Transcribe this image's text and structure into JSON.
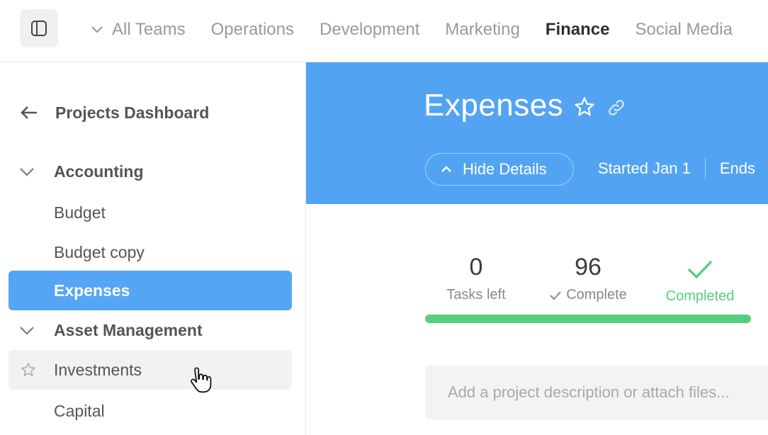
{
  "topbar": {
    "toggle_icon": "sidebar-panel-icon",
    "tabs": [
      {
        "label": "All Teams"
      },
      {
        "label": "Operations"
      },
      {
        "label": "Development"
      },
      {
        "label": "Marketing"
      },
      {
        "label": "Finance"
      },
      {
        "label": "Social Media"
      }
    ],
    "active_tab": "Finance"
  },
  "sidebar": {
    "back_label": "Projects Dashboard",
    "groups": [
      {
        "label": "Accounting",
        "items": [
          {
            "label": "Budget"
          },
          {
            "label": "Budget copy"
          },
          {
            "label": "Expenses"
          }
        ]
      },
      {
        "label": "Asset Management",
        "items": [
          {
            "label": "Investments"
          },
          {
            "label": "Capital"
          }
        ]
      }
    ],
    "active_item": "Expenses",
    "hover_item": "Investments"
  },
  "project": {
    "title": "Expenses",
    "hide_details_label": "Hide Details",
    "started": "Started Jan 1",
    "ends": "Ends"
  },
  "stats": {
    "tasks_left_value": "0",
    "tasks_left_label": "Tasks left",
    "complete_value": "96",
    "complete_label": "Complete",
    "completed_label": "Completed",
    "progress": 1.0
  },
  "description": {
    "placeholder": "Add a project description or attach files..."
  },
  "colors": {
    "accent": "#52a4f3",
    "active_item": "#55a5f5",
    "success": "#55cf7f"
  }
}
